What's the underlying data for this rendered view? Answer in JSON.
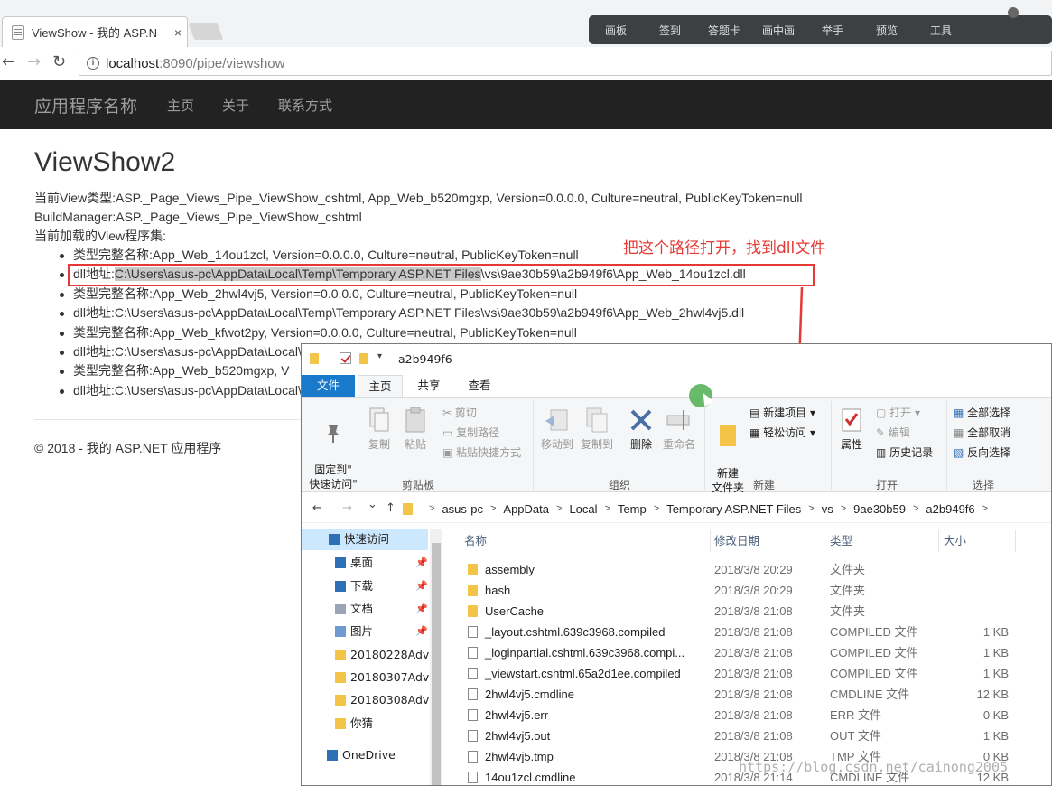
{
  "browser": {
    "tab_title": "ViewShow - 我的 ASP.N",
    "tab_close": "×",
    "url_host": "localhost",
    "url_rest": ":8090/pipe/viewshow",
    "info": "i",
    "back": "←",
    "forward": "→",
    "reload": "↻"
  },
  "recorder_toolbar": [
    "画板",
    "签到",
    "答题卡",
    "画中画",
    "举手",
    "预览",
    "工具"
  ],
  "navbar": {
    "brand": "应用程序名称",
    "links": [
      "主页",
      "关于",
      "联系方式"
    ]
  },
  "page": {
    "title": "ViewShow2",
    "view_type": "当前View类型:ASP._Page_Views_Pipe_ViewShow_cshtml, App_Web_b520mgxp, Version=0.0.0.0, Culture=neutral, PublicKeyToken=null",
    "build_manager": "BuildManager:ASP._Page_Views_Pipe_ViewShow_cshtml",
    "assemblies_label": "当前加载的View程序集:",
    "items": {
      "item1": "类型完整名称:App_Web_14ou1zcl, Version=0.0.0.0, Culture=neutral, PublicKeyToken=null",
      "item2_prefix": "dll地址:",
      "item2_highlight": "C:\\Users\\asus-pc\\AppData\\Local\\Temp\\Temporary ASP.NET Files",
      "item2_suffix": "\\vs\\9ae30b59\\a2b949f6\\App_Web_14ou1zcl.dll",
      "item3": "类型完整名称:App_Web_2hwl4vj5, Version=0.0.0.0, Culture=neutral, PublicKeyToken=null",
      "item4": "dll地址:C:\\Users\\asus-pc\\AppData\\Local\\Temp\\Temporary ASP.NET Files\\vs\\9ae30b59\\a2b949f6\\App_Web_2hwl4vj5.dll",
      "item5": "类型完整名称:App_Web_kfwot2py, Version=0.0.0.0, Culture=neutral, PublicKeyToken=null",
      "item6": "dll地址:C:\\Users\\asus-pc\\AppData\\Local\\Loc",
      "item7": "类型完整名称:App_Web_b520mgxp, V",
      "item8": "dll地址:C:\\Users\\asus-pc\\AppData\\Local\\Loc"
    },
    "footer": "© 2018 - 我的 ASP.NET 应用程序"
  },
  "annotation": "把这个路径打开，找到dll文件",
  "explorer": {
    "window_title": "a2b949f6",
    "qa_arrow": "▾",
    "tabs": {
      "file": "文件",
      "home": "主页",
      "share": "共享",
      "view": "查看"
    },
    "ribbon": {
      "pin": "固定到\"\n快速访问\"",
      "copy": "复制",
      "paste": "粘贴",
      "cut": "剪切",
      "copy_path": "复制路径",
      "paste_shortcut": "粘贴快捷方式",
      "clipboard": "剪贴板",
      "move_to": "移动到",
      "copy_to": "复制到",
      "delete": "删除",
      "rename": "重命名",
      "organize": "组织",
      "new_folder": "新建\n文件夹",
      "new_item": "新建项目 ▾",
      "easy_access": "轻松访问 ▾",
      "new": "新建",
      "properties": "属性",
      "open": "打开 ▾",
      "edit": "编辑",
      "history": "历史记录",
      "open_group": "打开",
      "select_all": "全部选择",
      "select_none": "全部取消",
      "invert": "反向选择",
      "select": "选择"
    },
    "address": {
      "back": "←",
      "forward": "→",
      "recent": "⌄",
      "up": "↑",
      "crumbs": [
        "asus-pc",
        "AppData",
        "Local",
        "Temp",
        "Temporary ASP.NET Files",
        "vs",
        "9ae30b59",
        "a2b949f6"
      ],
      "sep": ">"
    },
    "nav": [
      {
        "label": "快速访问",
        "pinned": false
      },
      {
        "label": "桌面",
        "pinned": true
      },
      {
        "label": "下载",
        "pinned": true
      },
      {
        "label": "文档",
        "pinned": true
      },
      {
        "label": "图片",
        "pinned": true
      },
      {
        "label": "20180228Adv",
        "pinned": false
      },
      {
        "label": "20180307Adv",
        "pinned": false
      },
      {
        "label": "20180308Adv",
        "pinned": false
      },
      {
        "label": "你猜",
        "pinned": false
      },
      {
        "label": "OneDrive",
        "pinned": false
      }
    ],
    "pin_glyph": "📌",
    "columns": {
      "name": "名称",
      "date": "修改日期",
      "type": "类型",
      "size": "大小"
    },
    "files": [
      {
        "name": "assembly",
        "date": "2018/3/8 20:29",
        "type": "文件夹",
        "size": "",
        "kind": "folder"
      },
      {
        "name": "hash",
        "date": "2018/3/8 20:29",
        "type": "文件夹",
        "size": "",
        "kind": "folder"
      },
      {
        "name": "UserCache",
        "date": "2018/3/8 21:08",
        "type": "文件夹",
        "size": "",
        "kind": "folder"
      },
      {
        "name": "_layout.cshtml.639c3968.compiled",
        "date": "2018/3/8 21:08",
        "type": "COMPILED 文件",
        "size": "1 KB",
        "kind": "doc"
      },
      {
        "name": "_loginpartial.cshtml.639c3968.compi...",
        "date": "2018/3/8 21:08",
        "type": "COMPILED 文件",
        "size": "1 KB",
        "kind": "doc"
      },
      {
        "name": "_viewstart.cshtml.65a2d1ee.compiled",
        "date": "2018/3/8 21:08",
        "type": "COMPILED 文件",
        "size": "1 KB",
        "kind": "doc"
      },
      {
        "name": "2hwl4vj5.cmdline",
        "date": "2018/3/8 21:08",
        "type": "CMDLINE 文件",
        "size": "12 KB",
        "kind": "doc"
      },
      {
        "name": "2hwl4vj5.err",
        "date": "2018/3/8 21:08",
        "type": "ERR 文件",
        "size": "0 KB",
        "kind": "doc"
      },
      {
        "name": "2hwl4vj5.out",
        "date": "2018/3/8 21:08",
        "type": "OUT 文件",
        "size": "1 KB",
        "kind": "doc"
      },
      {
        "name": "2hwl4vj5.tmp",
        "date": "2018/3/8 21:08",
        "type": "TMP 文件",
        "size": "0 KB",
        "kind": "doc"
      },
      {
        "name": "14ou1zcl.cmdline",
        "date": "2018/3/8 21:14",
        "type": "CMDLINE 文件",
        "size": "12 KB",
        "kind": "doc"
      }
    ]
  },
  "watermark": "https://blog.csdn.net/cainong2005"
}
